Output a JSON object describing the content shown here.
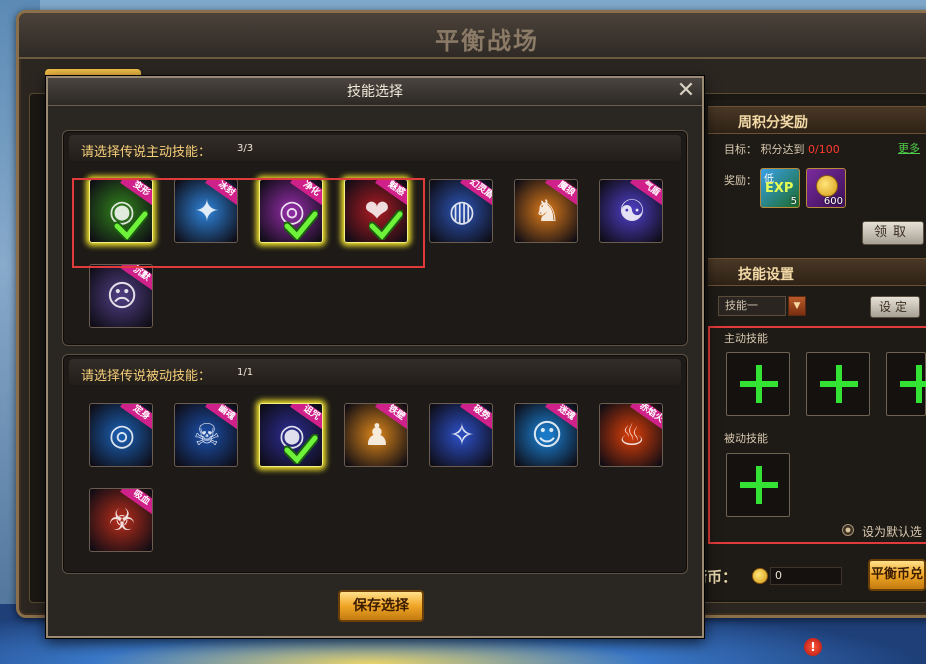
{
  "outer_window": {
    "title": "平衡战场"
  },
  "right_panel": {
    "weekly": {
      "header": "周积分奖励",
      "target_label": "目标：",
      "target_text": "积分达到",
      "target_progress": "0/100",
      "more_link": "更多",
      "reward_label": "奖励：",
      "rewards": [
        {
          "name": "EXP",
          "sub": "低",
          "count": "5"
        },
        {
          "name": "coin",
          "count": "600"
        }
      ],
      "claim_button": "领取"
    },
    "skill_settings": {
      "header": "技能设置",
      "selected_set": "技能一",
      "set_button": "设定",
      "active_label": "主动技能",
      "passive_label": "被动技能",
      "default_option": "设为默认选"
    },
    "currency_label": "衡币：",
    "currency_value": "0",
    "exchange_button": "平衡币兑"
  },
  "modal": {
    "title": "技能选择",
    "close_glyph": "✕",
    "active_section": {
      "title": "请选择传说主动技能：",
      "count": "3/3",
      "skills": [
        {
          "label": "变形",
          "selected": true,
          "color": "#2f7a1c",
          "glyph": "◉"
        },
        {
          "label": "冰封",
          "selected": false,
          "color": "#2b78c8",
          "glyph": "✦"
        },
        {
          "label": "净化",
          "selected": true,
          "color": "#8a2a9e",
          "glyph": "◎"
        },
        {
          "label": "魅惑",
          "selected": true,
          "color": "#9e1a22",
          "glyph": "❤"
        },
        {
          "label": "幻灵盾",
          "selected": false,
          "color": "#2a4fa8",
          "glyph": "◍"
        },
        {
          "label": "魔狼",
          "selected": false,
          "color": "#c8701a",
          "glyph": "♞"
        },
        {
          "label": "气盾",
          "selected": false,
          "color": "#4a3ab8",
          "glyph": "☯"
        },
        {
          "label": "沉默",
          "selected": false,
          "color": "#4a3a7a",
          "glyph": "☹"
        }
      ]
    },
    "passive_section": {
      "title": "请选择传说被动技能：",
      "count": "1/1",
      "skills": [
        {
          "label": "定身",
          "selected": false,
          "color": "#1a5aa8",
          "glyph": "◎"
        },
        {
          "label": "幽魂",
          "selected": false,
          "color": "#1a4a9e",
          "glyph": "☠"
        },
        {
          "label": "诅咒",
          "selected": true,
          "color": "#2a2a8a",
          "glyph": "◉"
        },
        {
          "label": "铁壁",
          "selected": false,
          "color": "#c87a1a",
          "glyph": "♟"
        },
        {
          "label": "破势",
          "selected": false,
          "color": "#2a4ab8",
          "glyph": "✧"
        },
        {
          "label": "迷魂",
          "selected": false,
          "color": "#1a7ac8",
          "glyph": "☺"
        },
        {
          "label": "赤焰火",
          "selected": false,
          "color": "#c83a0a",
          "glyph": "♨"
        },
        {
          "label": "吸血",
          "selected": false,
          "color": "#a82a1a",
          "glyph": "☣"
        }
      ]
    },
    "save_button": "保存选择"
  },
  "colors": {
    "accent": "#f6cf79",
    "highlight_red": "#e03a3a",
    "plus_green": "#34e234"
  },
  "notice": "!"
}
